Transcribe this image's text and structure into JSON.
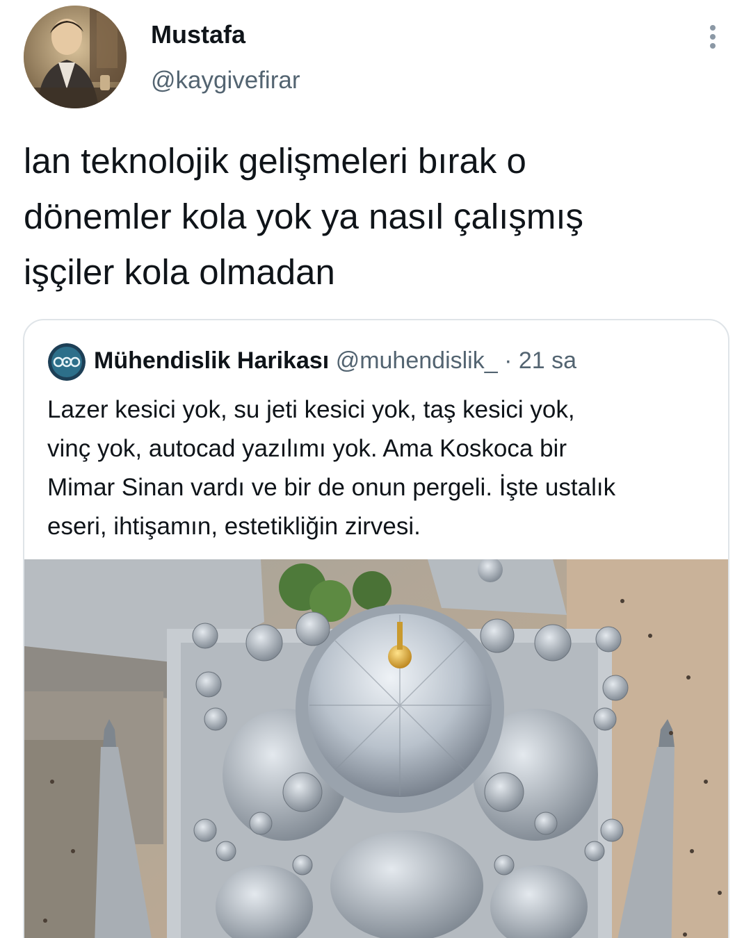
{
  "author": {
    "name": "Mustafa",
    "handle": "@kaygivefirar",
    "avatar_icon": "user-photo"
  },
  "more_icon": "more-vertical-icon",
  "tweet_text": "lan teknolojik gelişmeleri bırak o\ndönemler kola yok ya nasıl çalışmış\nişçiler kola olmadan",
  "quote": {
    "name": "Mühendislik Harikası",
    "handle": "@muhendislik_",
    "separator": "·",
    "time": "21 sa",
    "text": "Lazer kesici yok, su jeti kesici yok, taş kesici yok,\nvinç yok, autocad yazılımı yok. Ama Koskoca bir\nMimar Sinan vardı ve bir de onun pergeli. İşte ustalık\neseri, ihtişamın, estetikliğin zirvesi.",
    "image_icon": "mosque-aerial-photo"
  },
  "colors": {
    "text": "#0f1419",
    "muted": "#536471",
    "border": "#dfe4e8"
  }
}
